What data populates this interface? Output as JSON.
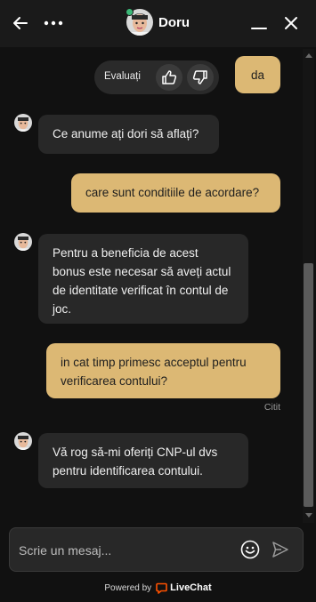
{
  "header": {
    "agent_name": "Doru",
    "icons": {
      "back": "arrow-left-icon",
      "more": "more-dots-icon",
      "minimize": "minimize-icon",
      "close": "close-icon"
    },
    "online_color": "#3cb878"
  },
  "rating": {
    "label": "Evaluați",
    "icons": {
      "up": "thumbs-up-icon",
      "down": "thumbs-down-icon"
    }
  },
  "messages": [
    {
      "from": "user",
      "text": "da"
    },
    {
      "from": "agent",
      "text": "Ce anume ați dori să aflați?"
    },
    {
      "from": "user",
      "text": "care sunt conditiile de acordare?"
    },
    {
      "from": "agent",
      "text": "Pentru a beneficia de acest bonus este necesar să aveți actul de identitate verificat în contul de joc."
    },
    {
      "from": "user",
      "text": "in cat timp primesc acceptul pentru verificarea contului?"
    },
    {
      "from": "agent",
      "text": "Vă rog să-mi oferiți CNP-ul dvs pentru identificarea contului."
    }
  ],
  "status": {
    "read": "Citit"
  },
  "composer": {
    "placeholder": "Scrie un mesaj...",
    "icons": {
      "emoji": "emoji-icon",
      "send": "send-icon"
    }
  },
  "footer": {
    "powered_by": "Powered by",
    "brand": "LiveChat"
  },
  "colors": {
    "user_bubble": "#dcb874",
    "agent_bubble": "#282828",
    "background": "#111111",
    "brand": "#ff5100"
  }
}
